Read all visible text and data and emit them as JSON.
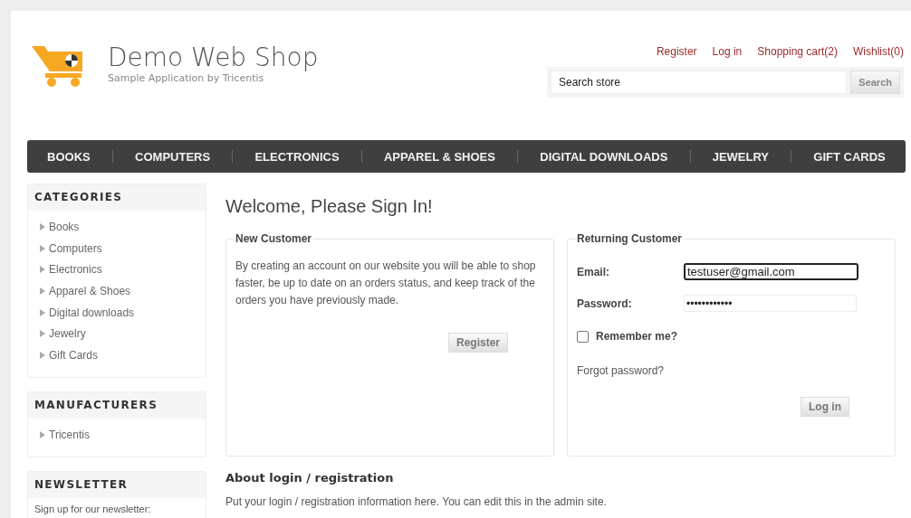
{
  "header": {
    "title": "Demo Web Shop",
    "subtitle": "Sample Application by Tricentis",
    "links": [
      "Register",
      "Log in",
      "Shopping cart(2)",
      "Wishlist(0)"
    ],
    "search": {
      "placeholder": "Search store",
      "button": "Search"
    }
  },
  "nav": [
    "BOOKS",
    "COMPUTERS",
    "ELECTRONICS",
    "APPAREL & SHOES",
    "DIGITAL DOWNLOADS",
    "JEWELRY",
    "GIFT CARDS"
  ],
  "sidebar": [
    {
      "title": "CATEGORIES",
      "kind": "list",
      "items": [
        "Books",
        "Computers",
        "Electronics",
        "Apparel & Shoes",
        "Digital downloads",
        "Jewelry",
        "Gift Cards"
      ]
    },
    {
      "title": "MANUFACTURERS",
      "kind": "list",
      "items": [
        "Tricentis"
      ]
    },
    {
      "title": "NEWSLETTER",
      "kind": "text",
      "text": "Sign up for our newsletter:"
    }
  ],
  "main": {
    "title": "Welcome, Please Sign In!",
    "new_customer": {
      "legend": "New Customer",
      "text": "By creating an account on our website you will be able to shop faster, be up to date on an orders status, and keep track of the orders you have previously made.",
      "button": "Register"
    },
    "returning_customer": {
      "legend": "Returning Customer",
      "email": {
        "label": "Email:",
        "value": "testuser@gmail.com",
        "focused": true
      },
      "password": {
        "label": "Password:",
        "value": "••••••••••••"
      },
      "remember": {
        "label": "Remember me?",
        "checked": false
      },
      "forgot": "Forgot password?",
      "button": "Log in"
    },
    "about": {
      "title": "About login / registration",
      "text": "Put your login / registration information here. You can edit this in the admin site."
    }
  }
}
